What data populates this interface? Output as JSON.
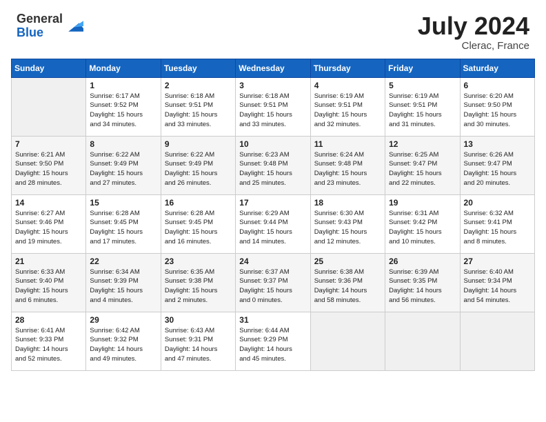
{
  "header": {
    "logo_general": "General",
    "logo_blue": "Blue",
    "month_year": "July 2024",
    "location": "Clerac, France"
  },
  "weekdays": [
    "Sunday",
    "Monday",
    "Tuesday",
    "Wednesday",
    "Thursday",
    "Friday",
    "Saturday"
  ],
  "weeks": [
    [
      {
        "day": "",
        "empty": true
      },
      {
        "day": "1",
        "sunrise": "Sunrise: 6:17 AM",
        "sunset": "Sunset: 9:52 PM",
        "daylight": "Daylight: 15 hours and 34 minutes."
      },
      {
        "day": "2",
        "sunrise": "Sunrise: 6:18 AM",
        "sunset": "Sunset: 9:51 PM",
        "daylight": "Daylight: 15 hours and 33 minutes."
      },
      {
        "day": "3",
        "sunrise": "Sunrise: 6:18 AM",
        "sunset": "Sunset: 9:51 PM",
        "daylight": "Daylight: 15 hours and 33 minutes."
      },
      {
        "day": "4",
        "sunrise": "Sunrise: 6:19 AM",
        "sunset": "Sunset: 9:51 PM",
        "daylight": "Daylight: 15 hours and 32 minutes."
      },
      {
        "day": "5",
        "sunrise": "Sunrise: 6:19 AM",
        "sunset": "Sunset: 9:51 PM",
        "daylight": "Daylight: 15 hours and 31 minutes."
      },
      {
        "day": "6",
        "sunrise": "Sunrise: 6:20 AM",
        "sunset": "Sunset: 9:50 PM",
        "daylight": "Daylight: 15 hours and 30 minutes."
      }
    ],
    [
      {
        "day": "7",
        "sunrise": "Sunrise: 6:21 AM",
        "sunset": "Sunset: 9:50 PM",
        "daylight": "Daylight: 15 hours and 28 minutes."
      },
      {
        "day": "8",
        "sunrise": "Sunrise: 6:22 AM",
        "sunset": "Sunset: 9:49 PM",
        "daylight": "Daylight: 15 hours and 27 minutes."
      },
      {
        "day": "9",
        "sunrise": "Sunrise: 6:22 AM",
        "sunset": "Sunset: 9:49 PM",
        "daylight": "Daylight: 15 hours and 26 minutes."
      },
      {
        "day": "10",
        "sunrise": "Sunrise: 6:23 AM",
        "sunset": "Sunset: 9:48 PM",
        "daylight": "Daylight: 15 hours and 25 minutes."
      },
      {
        "day": "11",
        "sunrise": "Sunrise: 6:24 AM",
        "sunset": "Sunset: 9:48 PM",
        "daylight": "Daylight: 15 hours and 23 minutes."
      },
      {
        "day": "12",
        "sunrise": "Sunrise: 6:25 AM",
        "sunset": "Sunset: 9:47 PM",
        "daylight": "Daylight: 15 hours and 22 minutes."
      },
      {
        "day": "13",
        "sunrise": "Sunrise: 6:26 AM",
        "sunset": "Sunset: 9:47 PM",
        "daylight": "Daylight: 15 hours and 20 minutes."
      }
    ],
    [
      {
        "day": "14",
        "sunrise": "Sunrise: 6:27 AM",
        "sunset": "Sunset: 9:46 PM",
        "daylight": "Daylight: 15 hours and 19 minutes."
      },
      {
        "day": "15",
        "sunrise": "Sunrise: 6:28 AM",
        "sunset": "Sunset: 9:45 PM",
        "daylight": "Daylight: 15 hours and 17 minutes."
      },
      {
        "day": "16",
        "sunrise": "Sunrise: 6:28 AM",
        "sunset": "Sunset: 9:45 PM",
        "daylight": "Daylight: 15 hours and 16 minutes."
      },
      {
        "day": "17",
        "sunrise": "Sunrise: 6:29 AM",
        "sunset": "Sunset: 9:44 PM",
        "daylight": "Daylight: 15 hours and 14 minutes."
      },
      {
        "day": "18",
        "sunrise": "Sunrise: 6:30 AM",
        "sunset": "Sunset: 9:43 PM",
        "daylight": "Daylight: 15 hours and 12 minutes."
      },
      {
        "day": "19",
        "sunrise": "Sunrise: 6:31 AM",
        "sunset": "Sunset: 9:42 PM",
        "daylight": "Daylight: 15 hours and 10 minutes."
      },
      {
        "day": "20",
        "sunrise": "Sunrise: 6:32 AM",
        "sunset": "Sunset: 9:41 PM",
        "daylight": "Daylight: 15 hours and 8 minutes."
      }
    ],
    [
      {
        "day": "21",
        "sunrise": "Sunrise: 6:33 AM",
        "sunset": "Sunset: 9:40 PM",
        "daylight": "Daylight: 15 hours and 6 minutes."
      },
      {
        "day": "22",
        "sunrise": "Sunrise: 6:34 AM",
        "sunset": "Sunset: 9:39 PM",
        "daylight": "Daylight: 15 hours and 4 minutes."
      },
      {
        "day": "23",
        "sunrise": "Sunrise: 6:35 AM",
        "sunset": "Sunset: 9:38 PM",
        "daylight": "Daylight: 15 hours and 2 minutes."
      },
      {
        "day": "24",
        "sunrise": "Sunrise: 6:37 AM",
        "sunset": "Sunset: 9:37 PM",
        "daylight": "Daylight: 15 hours and 0 minutes."
      },
      {
        "day": "25",
        "sunrise": "Sunrise: 6:38 AM",
        "sunset": "Sunset: 9:36 PM",
        "daylight": "Daylight: 14 hours and 58 minutes."
      },
      {
        "day": "26",
        "sunrise": "Sunrise: 6:39 AM",
        "sunset": "Sunset: 9:35 PM",
        "daylight": "Daylight: 14 hours and 56 minutes."
      },
      {
        "day": "27",
        "sunrise": "Sunrise: 6:40 AM",
        "sunset": "Sunset: 9:34 PM",
        "daylight": "Daylight: 14 hours and 54 minutes."
      }
    ],
    [
      {
        "day": "28",
        "sunrise": "Sunrise: 6:41 AM",
        "sunset": "Sunset: 9:33 PM",
        "daylight": "Daylight: 14 hours and 52 minutes."
      },
      {
        "day": "29",
        "sunrise": "Sunrise: 6:42 AM",
        "sunset": "Sunset: 9:32 PM",
        "daylight": "Daylight: 14 hours and 49 minutes."
      },
      {
        "day": "30",
        "sunrise": "Sunrise: 6:43 AM",
        "sunset": "Sunset: 9:31 PM",
        "daylight": "Daylight: 14 hours and 47 minutes."
      },
      {
        "day": "31",
        "sunrise": "Sunrise: 6:44 AM",
        "sunset": "Sunset: 9:29 PM",
        "daylight": "Daylight: 14 hours and 45 minutes."
      },
      {
        "day": "",
        "empty": true
      },
      {
        "day": "",
        "empty": true
      },
      {
        "day": "",
        "empty": true
      }
    ]
  ]
}
